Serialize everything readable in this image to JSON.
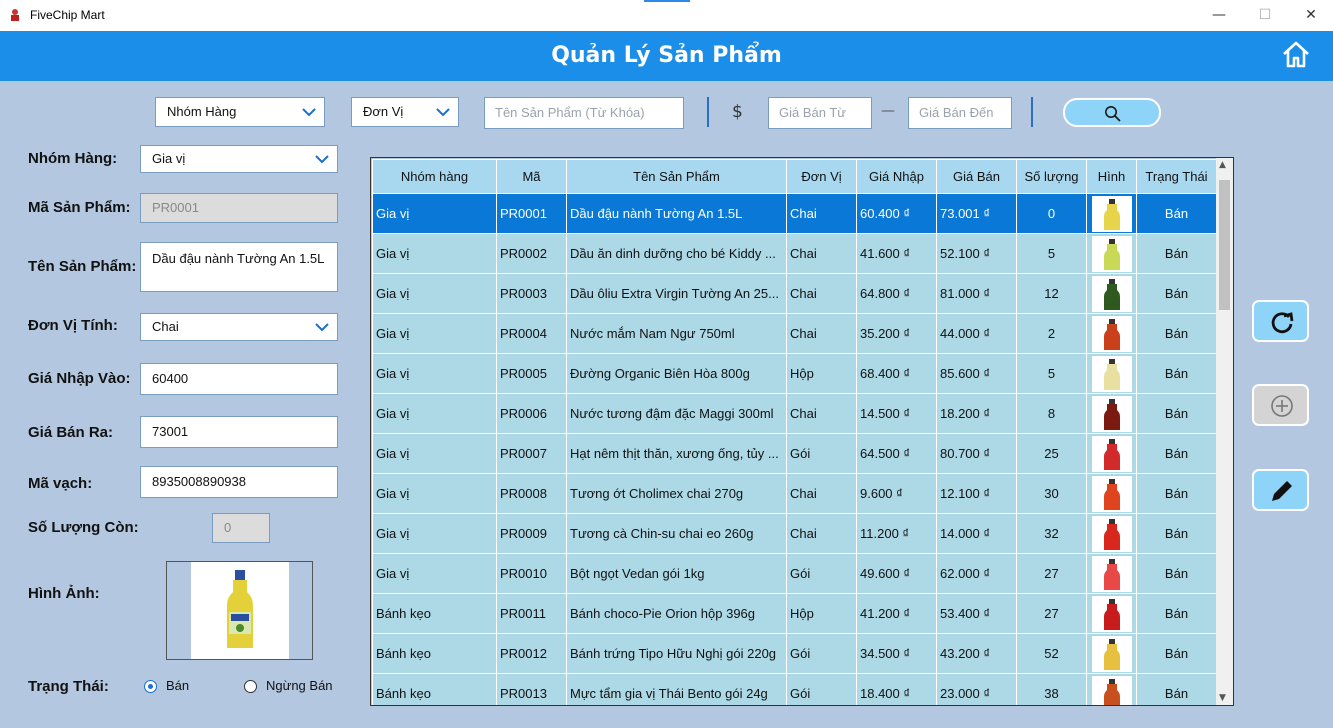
{
  "window": {
    "title": "FiveChip Mart",
    "minimize": "—",
    "maximize": "☐",
    "close": "✕"
  },
  "header": {
    "title": "Quản Lý Sản Phẩm"
  },
  "filters": {
    "group": "Nhóm Hàng",
    "unit": "Đơn Vị",
    "name_placeholder": "Tên Sản Phẩm (Từ Khóa)",
    "currency": "$",
    "price_from_placeholder": "Giá Bán Từ",
    "dash": "—",
    "price_to_placeholder": "Giá Bán Đến"
  },
  "form": {
    "group_label": "Nhóm Hàng:",
    "group_value": "Gia vị",
    "code_label": "Mã Sản Phẩm:",
    "code_value": "PR0001",
    "name_label": "Tên Sản Phẩm:",
    "name_value": "Dầu đậu nành Tường An 1.5L",
    "unit_label": "Đơn Vị Tính:",
    "unit_value": "Chai",
    "import_label": "Giá Nhập Vào:",
    "import_value": "60400",
    "sale_label": "Giá Bán Ra:",
    "sale_value": "73001",
    "barcode_label": "Mã vạch:",
    "barcode_value": "8935008890938",
    "qty_label": "Số Lượng Còn:",
    "qty_value": "0",
    "image_label": "Hình Ảnh:",
    "status_label": "Trạng Thái:",
    "status_on": "Bán",
    "status_off": "Ngừng Bán"
  },
  "table": {
    "headers": [
      "Nhóm hàng",
      "Mã",
      "Tên Sản Phẩm",
      "Đơn Vị",
      "Giá Nhập",
      "Giá Bán",
      "Số lượng",
      "Hình",
      "Trạng Thái"
    ],
    "rows": [
      [
        "Gia vị",
        "PR0001",
        "Dầu đậu nành Tường An 1.5L",
        "Chai",
        "60.400 ₫",
        "73.001 ₫",
        "0",
        "",
        "Bán"
      ],
      [
        "Gia vị",
        "PR0002",
        "Dầu ăn dinh dưỡng cho bé Kiddy ...",
        "Chai",
        "41.600 ₫",
        "52.100 ₫",
        "5",
        "",
        "Bán"
      ],
      [
        "Gia vị",
        "PR0003",
        "Dầu ôliu Extra Virgin Tường An 25...",
        "Chai",
        "64.800 ₫",
        "81.000 ₫",
        "12",
        "",
        "Bán"
      ],
      [
        "Gia vị",
        "PR0004",
        "Nước mắm Nam Ngư 750ml",
        "Chai",
        "35.200 ₫",
        "44.000 ₫",
        "2",
        "",
        "Bán"
      ],
      [
        "Gia vị",
        "PR0005",
        "Đường Organic Biên Hòa 800g",
        "Hộp",
        "68.400 ₫",
        "85.600 ₫",
        "5",
        "",
        "Bán"
      ],
      [
        "Gia vị",
        "PR0006",
        "Nước tương đậm đặc Maggi 300ml",
        "Chai",
        "14.500 ₫",
        "18.200 ₫",
        "8",
        "",
        "Bán"
      ],
      [
        "Gia vị",
        "PR0007",
        "Hạt nêm thịt thăn, xương ống, tủy ...",
        "Gói",
        "64.500 ₫",
        "80.700 ₫",
        "25",
        "",
        "Bán"
      ],
      [
        "Gia vị",
        "PR0008",
        "Tương ớt Cholimex chai 270g",
        "Chai",
        "9.600 ₫",
        "12.100 ₫",
        "30",
        "",
        "Bán"
      ],
      [
        "Gia vị",
        "PR0009",
        "Tương cà Chin-su chai eo 260g",
        "Chai",
        "11.200 ₫",
        "14.000 ₫",
        "32",
        "",
        "Bán"
      ],
      [
        "Gia vị",
        "PR0010",
        "Bột ngọt Vedan gói 1kg",
        "Gói",
        "49.600 ₫",
        "62.000 ₫",
        "27",
        "",
        "Bán"
      ],
      [
        "Bánh kẹo",
        "PR0011",
        "Bánh choco-Pie Orion hộp 396g",
        "Hộp",
        "41.200 ₫",
        "53.400 ₫",
        "27",
        "",
        "Bán"
      ],
      [
        "Bánh kẹo",
        "PR0012",
        "Bánh trứng Tipo Hữu Nghị gói 220g",
        "Gói",
        "34.500 ₫",
        "43.200 ₫",
        "52",
        "",
        "Bán"
      ],
      [
        "Bánh kẹo",
        "PR0013",
        "Mực tẩm gia vị Thái Bento gói 24g",
        "Gói",
        "18.400 ₫",
        "23.000 ₫",
        "38",
        "",
        "Bán"
      ]
    ],
    "thumb_colors": [
      "#e8d44a",
      "#c9d857",
      "#2f5a1f",
      "#c9401a",
      "#e8e0a0",
      "#7a1a10",
      "#d22a2a",
      "#e0441e",
      "#d8281e",
      "#e84848",
      "#c81c1c",
      "#e8c040",
      "#c8501e"
    ]
  },
  "actions": {
    "refresh": "refresh",
    "add": "add",
    "edit": "edit"
  }
}
